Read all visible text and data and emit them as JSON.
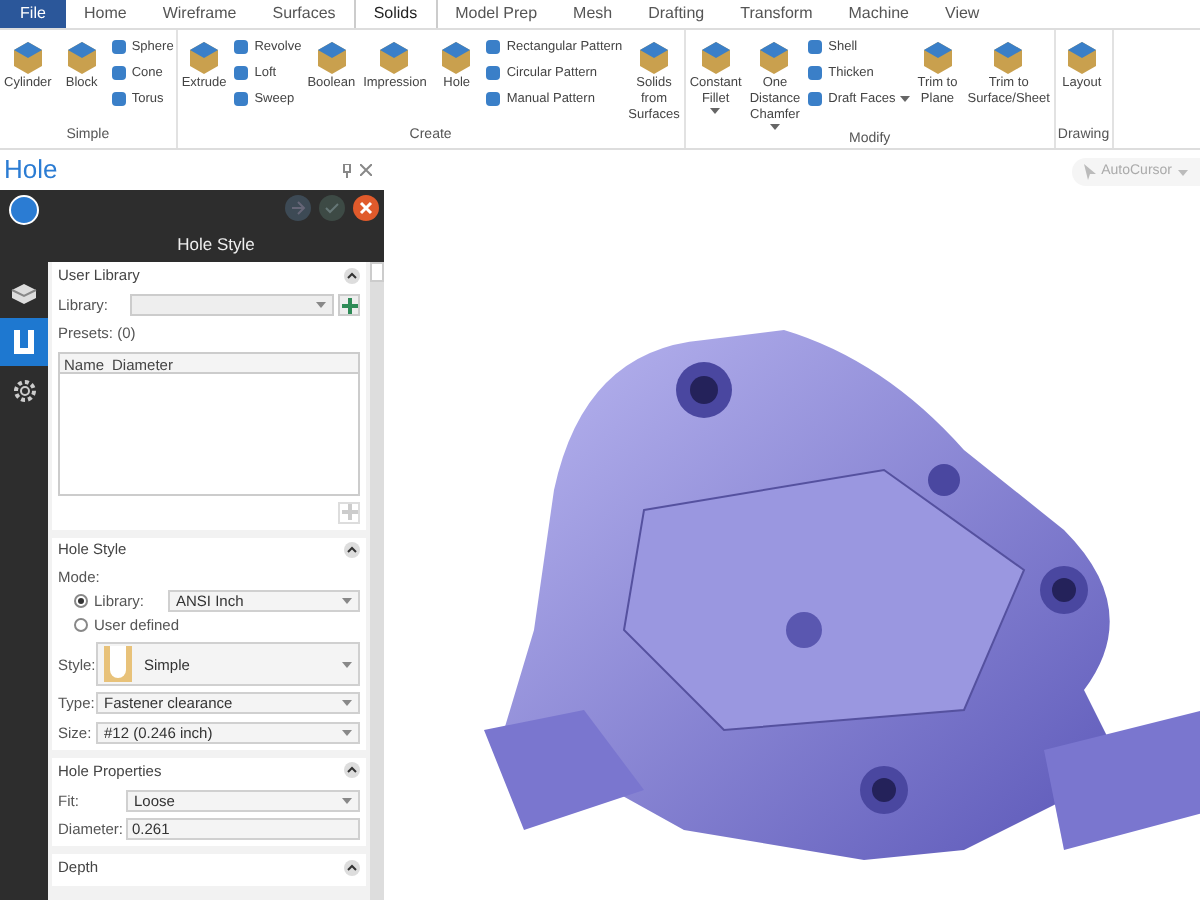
{
  "menu_tabs": [
    {
      "label": "File",
      "selected": false,
      "kind": "file"
    },
    {
      "label": "Home",
      "selected": false,
      "kind": "tab"
    },
    {
      "label": "Wireframe",
      "selected": false,
      "kind": "tab"
    },
    {
      "label": "Surfaces",
      "selected": false,
      "kind": "tab"
    },
    {
      "label": "Solids",
      "selected": true,
      "kind": "tab"
    },
    {
      "label": "Model Prep",
      "selected": false,
      "kind": "tab"
    },
    {
      "label": "Mesh",
      "selected": false,
      "kind": "tab"
    },
    {
      "label": "Drafting",
      "selected": false,
      "kind": "tab"
    },
    {
      "label": "Transform",
      "selected": false,
      "kind": "tab"
    },
    {
      "label": "Machine",
      "selected": false,
      "kind": "tab"
    },
    {
      "label": "View",
      "selected": false,
      "kind": "tab"
    }
  ],
  "ribbon_groups": [
    {
      "label": "Simple",
      "items": [
        {
          "kind": "large",
          "label": "Cylinder",
          "dropdown": false
        },
        {
          "kind": "large",
          "label": "Block",
          "dropdown": false
        },
        {
          "kind": "stack",
          "items": [
            {
              "label": "Sphere",
              "dropdown": false
            },
            {
              "label": "Cone",
              "dropdown": false
            },
            {
              "label": "Torus",
              "dropdown": false
            }
          ]
        }
      ]
    },
    {
      "label": "Create",
      "items": [
        {
          "kind": "large",
          "label": "Extrude",
          "dropdown": false
        },
        {
          "kind": "stack",
          "items": [
            {
              "label": "Revolve",
              "dropdown": false
            },
            {
              "label": "Loft",
              "dropdown": false
            },
            {
              "label": "Sweep",
              "dropdown": false
            }
          ]
        },
        {
          "kind": "large",
          "label": "Boolean",
          "dropdown": false
        },
        {
          "kind": "large",
          "label": "Impression",
          "dropdown": false
        },
        {
          "kind": "large",
          "label": "Hole",
          "dropdown": false
        },
        {
          "kind": "stack",
          "items": [
            {
              "label": "Rectangular Pattern",
              "dropdown": false
            },
            {
              "label": "Circular Pattern",
              "dropdown": false
            },
            {
              "label": "Manual Pattern",
              "dropdown": false
            }
          ]
        },
        {
          "kind": "large",
          "label": "Solids from Surfaces",
          "dropdown": false
        }
      ]
    },
    {
      "label": "Modify",
      "items": [
        {
          "kind": "large",
          "label": "Constant Fillet",
          "dropdown": true
        },
        {
          "kind": "large",
          "label": "One Distance Chamfer",
          "dropdown": true
        },
        {
          "kind": "stack",
          "items": [
            {
              "label": "Shell",
              "dropdown": false
            },
            {
              "label": "Thicken",
              "dropdown": false
            },
            {
              "label": "Draft Faces",
              "dropdown": true
            }
          ]
        },
        {
          "kind": "large",
          "label": "Trim to Plane",
          "dropdown": false
        },
        {
          "kind": "large",
          "label": "Trim to Surface/Sheet",
          "dropdown": false
        }
      ]
    },
    {
      "label": "Drawing",
      "items": [
        {
          "kind": "large",
          "label": "Layout",
          "dropdown": false
        }
      ]
    }
  ],
  "panel": {
    "title": "Hole",
    "dialog_title": "Hole Style",
    "side_tabs": [
      {
        "selected": false
      },
      {
        "selected": true
      },
      {
        "selected": false
      }
    ],
    "user_library": {
      "title": "User Library",
      "library_label": "Library:",
      "presets_label": "Presets: (0)",
      "columns": [
        "Name",
        "Diameter"
      ]
    },
    "hole_style": {
      "title": "Hole Style",
      "mode_label": "Mode:",
      "modes": [
        {
          "label": "Library:",
          "selected": true,
          "value": "ANSI Inch"
        },
        {
          "label": "User defined",
          "selected": false
        }
      ],
      "style_label": "Style:",
      "style_value": "Simple",
      "type_label": "Type:",
      "type_value": "Fastener clearance",
      "size_label": "Size:",
      "size_value": "#12 (0.246 inch)"
    },
    "hole_properties": {
      "title": "Hole Properties",
      "fit_label": "Fit:",
      "fit_value": "Loose",
      "diameter_label": "Diameter:",
      "diameter_value": "0.261"
    },
    "depth": {
      "title": "Depth"
    }
  },
  "viewport": {
    "autocursor": "AutoCursor"
  }
}
